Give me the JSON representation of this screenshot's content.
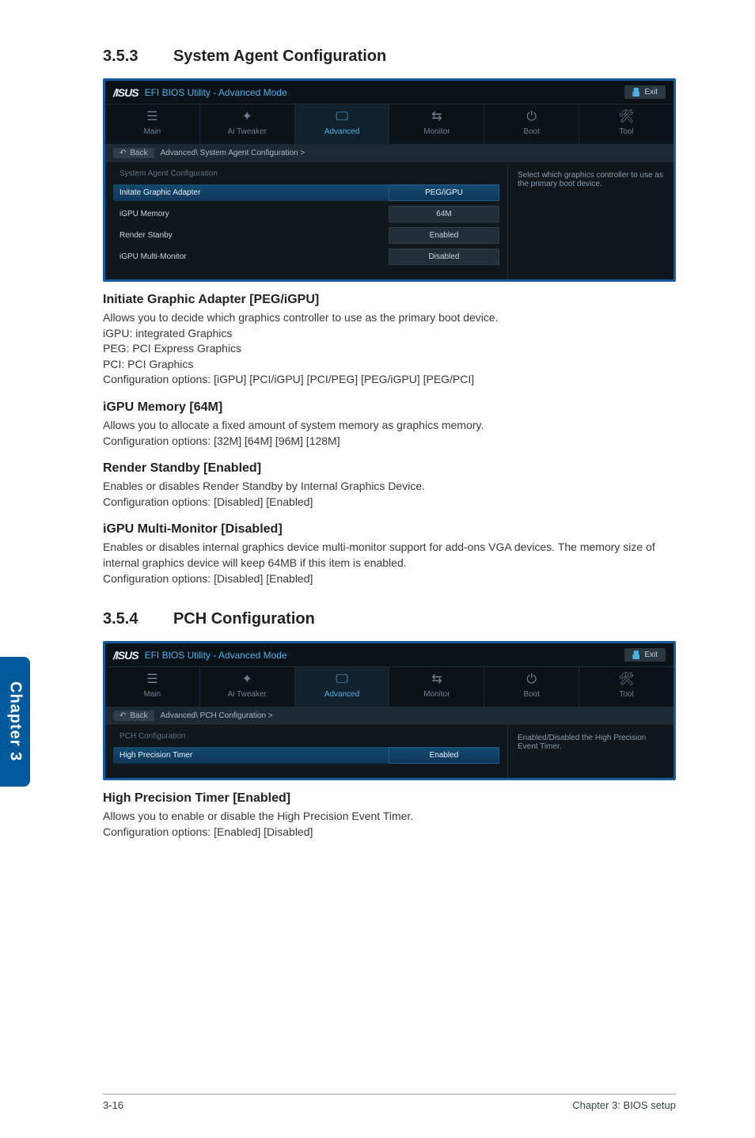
{
  "sideTab": "Chapter 3",
  "footer": {
    "left": "3-16",
    "right": "Chapter 3: BIOS setup"
  },
  "sec353": {
    "num": "3.5.3",
    "title": "System Agent Configuration"
  },
  "bios1": {
    "logo": "/ISUS",
    "modeLabel": "EFI BIOS Utility - Advanced Mode",
    "exit": "Exit",
    "tabs": {
      "main": "Main",
      "ai": "Ai  Tweaker",
      "advanced": "Advanced",
      "monitor": "Monitor",
      "boot": "Boot",
      "tool": "Tool"
    },
    "crumb": {
      "back": "Back",
      "path": "Advanced\\ System Agent Configuration  >"
    },
    "cfgTitle": "System Agent Configuration",
    "help": "Select which graphics controller to use as the primary boot device.",
    "rows": {
      "initate": {
        "label": "Initate Graphic Adapter",
        "value": "PEG/iGPU"
      },
      "mem": {
        "label": "iGPU Memory",
        "value": "64M"
      },
      "render": {
        "label": "Render Stanby",
        "value": "Enabled"
      },
      "multi": {
        "label": "iGPU Multi-Monitor",
        "value": "Disabled"
      }
    }
  },
  "sub1": {
    "h": "Initiate Graphic Adapter [PEG/iGPU]",
    "l1": "Allows you to decide which graphics controller to use as the primary boot device.",
    "l2": "iGPU: integrated Graphics",
    "l3": "PEG: PCI Express Graphics",
    "l4": "PCI: PCI Graphics",
    "l5": "Configuration options: [iGPU] [PCI/iGPU] [PCI/PEG] [PEG/iGPU] [PEG/PCI]"
  },
  "sub2": {
    "h": "iGPU Memory [64M]",
    "l1": "Allows you to allocate a fixed amount of system memory as graphics memory.",
    "l2": "Configuration options: [32M] [64M] [96M] [128M]"
  },
  "sub3": {
    "h": "Render Standby [Enabled]",
    "l1": "Enables or disables Render Standby by Internal Graphics Device.",
    "l2": "Configuration options: [Disabled] [Enabled]"
  },
  "sub4": {
    "h": "iGPU Multi-Monitor [Disabled]",
    "l1": "Enables or disables internal graphics device multi-monitor support for add-ons VGA devices. The memory size of internal graphics device will keep 64MB if this item is enabled.",
    "l2": "Configuration options: [Disabled] [Enabled]"
  },
  "sec354": {
    "num": "3.5.4",
    "title": "PCH Configuration"
  },
  "bios2": {
    "logo": "/ISUS",
    "modeLabel": "EFI BIOS Utility - Advanced Mode",
    "exit": "Exit",
    "tabs": {
      "main": "Main",
      "ai": "Ai  Tweaker",
      "advanced": "Advanced",
      "monitor": "Monitor",
      "boot": "Boot",
      "tool": "Tool"
    },
    "crumb": {
      "back": "Back",
      "path": "Advanced\\ PCH Configuration  >"
    },
    "cfgTitle": "PCH Configuration",
    "help": "Enabled/Disabled the High Precision Event Timer.",
    "rows": {
      "hpt": {
        "label": "High Precision Timer",
        "value": "Enabled"
      }
    }
  },
  "sub5": {
    "h": "High Precision Timer [Enabled]",
    "l1": "Allows you to enable or disable the High Precision Event Timer.",
    "l2": "Configuration options: [Enabled] [Disabled]"
  }
}
